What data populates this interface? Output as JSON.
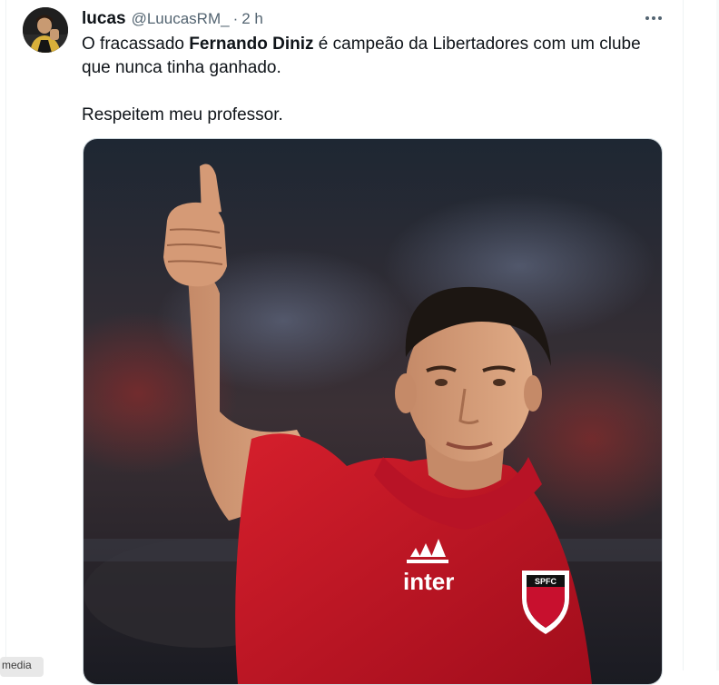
{
  "tweet": {
    "author_name": "lucas",
    "author_handle": "@LuucasRM_",
    "separator": "·",
    "time": "2 h",
    "text_part1": "O fracassado ",
    "text_bold": "Fernando Diniz",
    "text_part2": " é campeão da Libertadores com um clube que nunca tinha ganhado.",
    "text_line2": "Respeitem meu professor.",
    "image": {
      "shirt_brand": "inter",
      "crest_text": "SPFC"
    }
  },
  "tooltip": {
    "label": "media"
  },
  "icons": {
    "more": "more-horizontal-icon",
    "avatar": "avatar-image"
  },
  "colors": {
    "text": "#0f1419",
    "secondary": "#536471",
    "border": "#cfd9de",
    "shirt": "#c8102e"
  }
}
